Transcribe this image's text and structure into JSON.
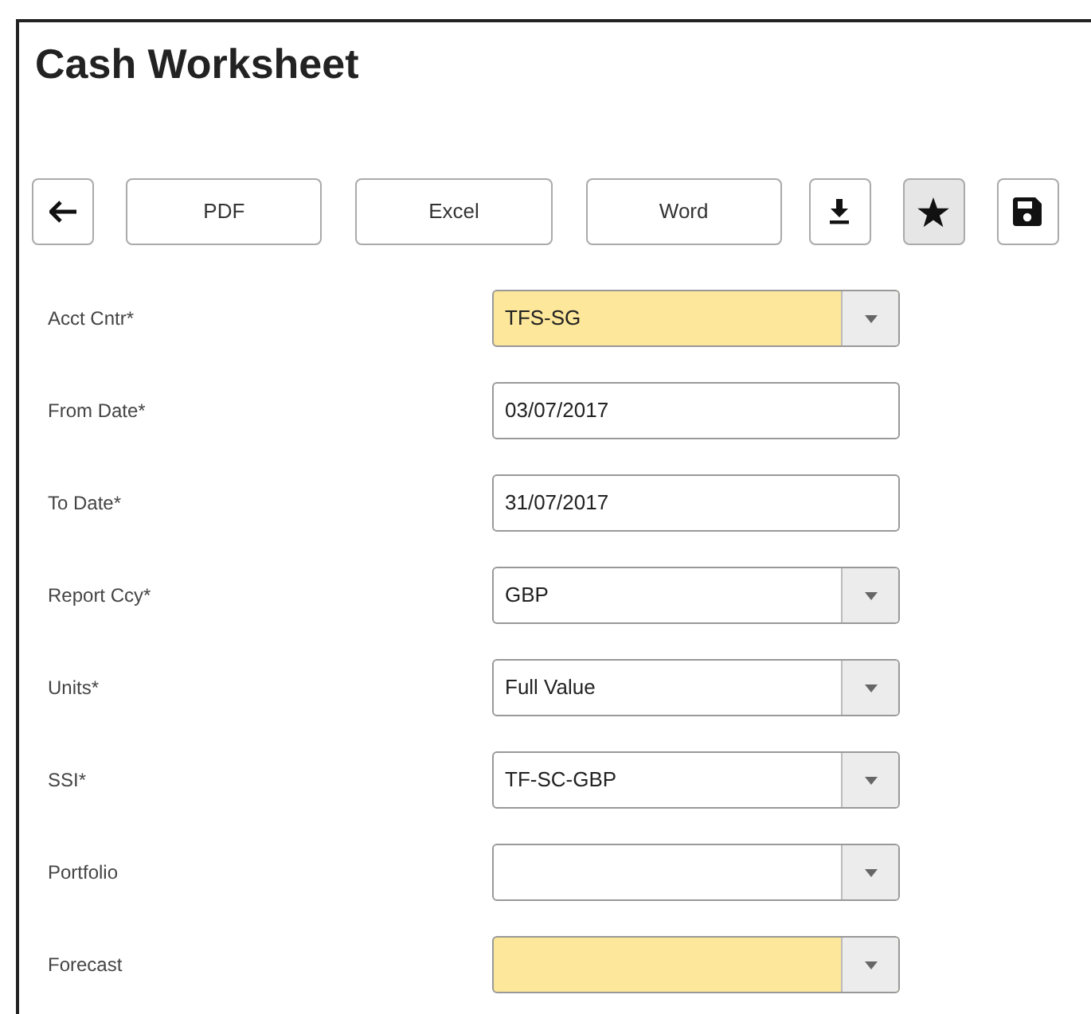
{
  "title": "Cash Worksheet",
  "toolbar": [
    {
      "kind": "back",
      "active": false
    },
    {
      "kind": "text",
      "label": "PDF",
      "active": false
    },
    {
      "kind": "text",
      "label": "Excel",
      "active": false
    },
    {
      "kind": "text",
      "label": "Word",
      "active": false
    },
    {
      "kind": "download",
      "active": false
    },
    {
      "kind": "star",
      "active": true
    },
    {
      "kind": "save",
      "active": false
    }
  ],
  "fields": [
    {
      "label": "Acct Cntr*",
      "kind": "select",
      "value": "TFS-SG",
      "highlighted": true
    },
    {
      "label": "From Date*",
      "kind": "text",
      "value": "03/07/2017",
      "highlighted": false
    },
    {
      "label": "To Date*",
      "kind": "text",
      "value": "31/07/2017",
      "highlighted": false
    },
    {
      "label": "Report Ccy*",
      "kind": "select",
      "value": "GBP",
      "highlighted": false
    },
    {
      "label": "Units*",
      "kind": "select",
      "value": "Full Value",
      "highlighted": false
    },
    {
      "label": "SSI*",
      "kind": "select",
      "value": "TF-SC-GBP",
      "highlighted": false
    },
    {
      "label": "Portfolio",
      "kind": "select",
      "highlighted": false
    },
    {
      "label": "Forecast",
      "kind": "select",
      "highlighted": true
    }
  ]
}
